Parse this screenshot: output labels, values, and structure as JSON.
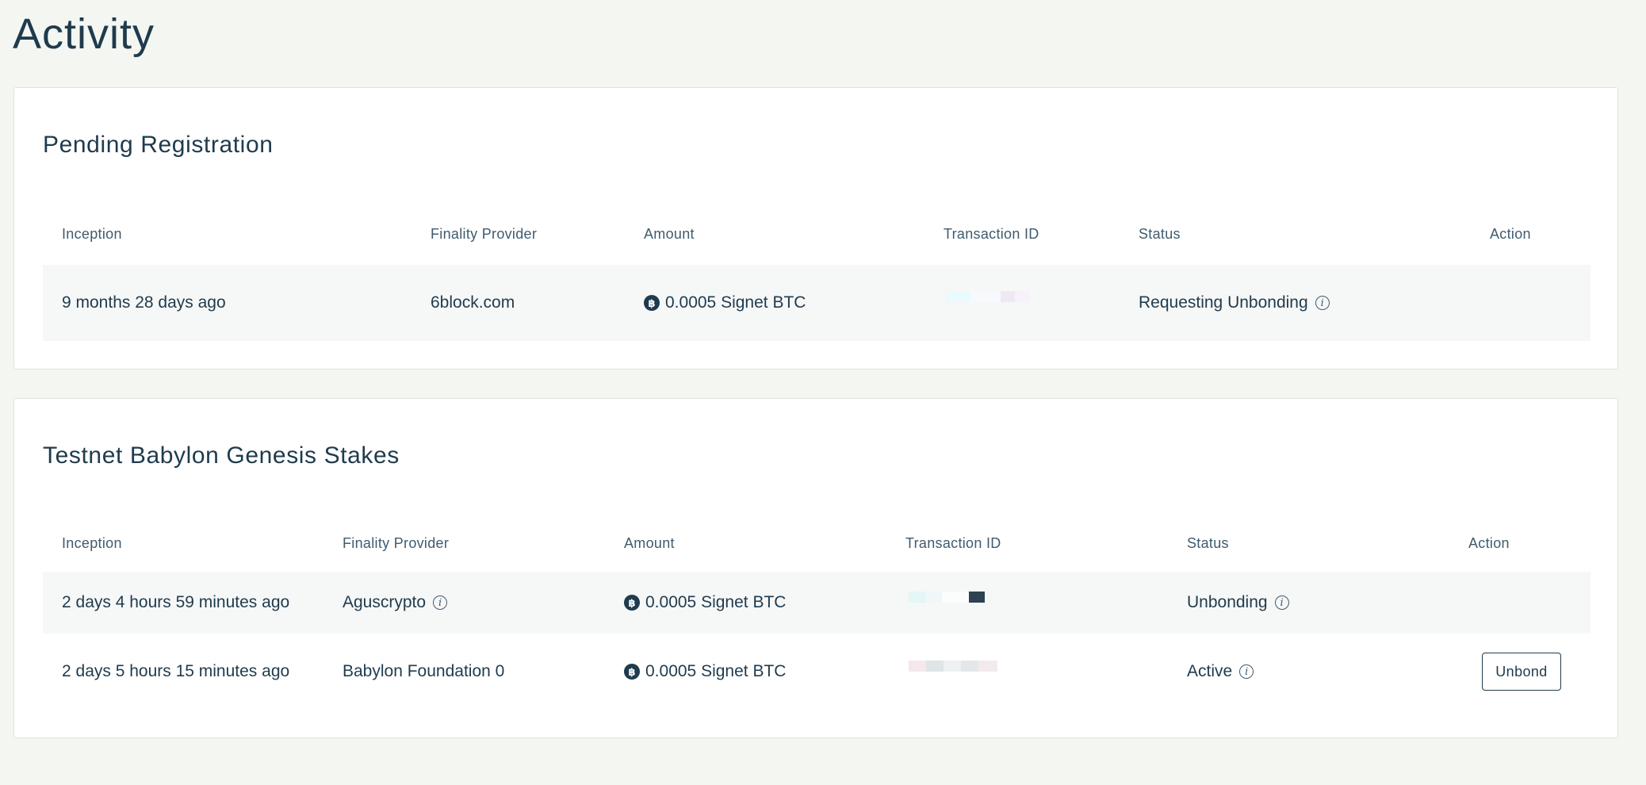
{
  "page": {
    "title": "Activity"
  },
  "pending": {
    "title": "Pending Registration",
    "columns": {
      "inception": "Inception",
      "provider": "Finality Provider",
      "amount": "Amount",
      "txid": "Transaction ID",
      "status": "Status",
      "action": "Action"
    },
    "rows": [
      {
        "inception": "9 months 28 days ago",
        "provider": "6block.com",
        "amount": "0.0005 Signet BTC",
        "status": "Requesting Unbonding"
      }
    ]
  },
  "stakes": {
    "title": "Testnet Babylon Genesis Stakes",
    "columns": {
      "inception": "Inception",
      "provider": "Finality Provider",
      "amount": "Amount",
      "txid": "Transaction ID",
      "status": "Status",
      "action": "Action"
    },
    "rows": [
      {
        "inception": "2 days 4 hours 59 minutes ago",
        "provider": "Aguscrypto",
        "amount": "0.0005 Signet BTC",
        "status": "Unbonding",
        "action": ""
      },
      {
        "inception": "2 days 5 hours 15 minutes ago",
        "provider": "Babylon Foundation 0",
        "amount": "0.0005 Signet BTC",
        "status": "Active",
        "action": "Unbond"
      }
    ]
  },
  "icons": {
    "btc": "bitcoin-icon",
    "info": "info-icon",
    "btc_glyph": "฿",
    "info_glyph": "i"
  },
  "colors": {
    "background": "#f3f6f1",
    "card": "#ffffff",
    "text": "#1f3b4d",
    "row_shade": "#f6f7f7"
  }
}
